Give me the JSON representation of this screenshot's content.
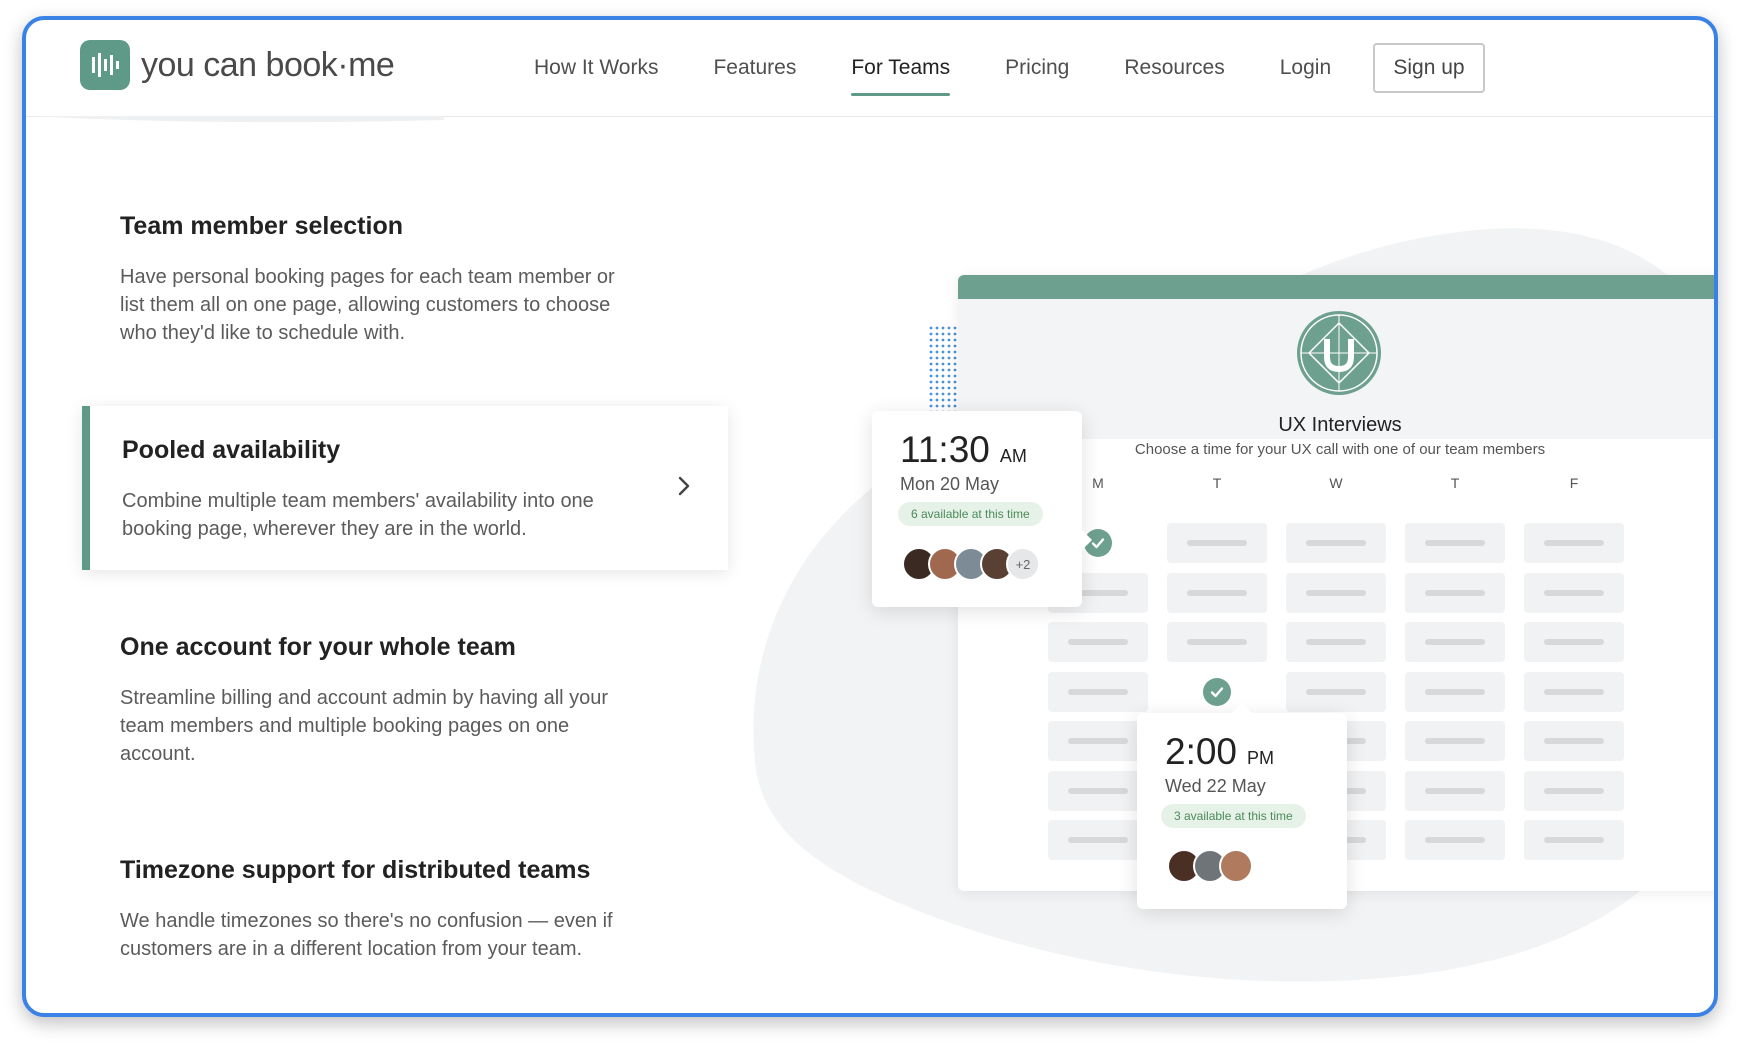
{
  "brand": {
    "name": "you can book·me",
    "accent": "#5f9a88"
  },
  "nav": {
    "items": [
      {
        "label": "How It Works"
      },
      {
        "label": "Features"
      },
      {
        "label": "For Teams",
        "active": true
      },
      {
        "label": "Pricing"
      },
      {
        "label": "Resources"
      },
      {
        "label": "Login"
      }
    ],
    "signup": "Sign up"
  },
  "features": [
    {
      "title": "Team member selection",
      "desc": "Have personal booking pages for each team member or list them all on one page, allowing customers to choose who they'd like to schedule with."
    },
    {
      "title": "Pooled availability",
      "desc": "Combine multiple team members' availability into one booking page, wherever they are in the world."
    },
    {
      "title": "One account for your whole team",
      "desc": "Streamline billing and account admin by having all your team members and multiple booking pages on one account."
    },
    {
      "title": "Timezone support for distributed teams",
      "desc": "We handle timezones so there's no confusion — even if customers are in a different location from your team."
    }
  ],
  "booking": {
    "title": "UX Interviews",
    "subtitle": "Choose a time for your UX call with one of our team members",
    "days": [
      "M",
      "T",
      "W",
      "T",
      "F"
    ],
    "popup1": {
      "time": "11:30",
      "ampm": "AM",
      "date": "Mon 20 May",
      "badge": "6 available at this time",
      "more": "+2"
    },
    "popup2": {
      "time": "2:00",
      "ampm": "PM",
      "date": "Wed 22 May",
      "badge": "3 available at this time"
    }
  },
  "icons": [
    "logo-icon",
    "chevron-right-icon",
    "check-icon",
    "brand-emblem-icon"
  ]
}
